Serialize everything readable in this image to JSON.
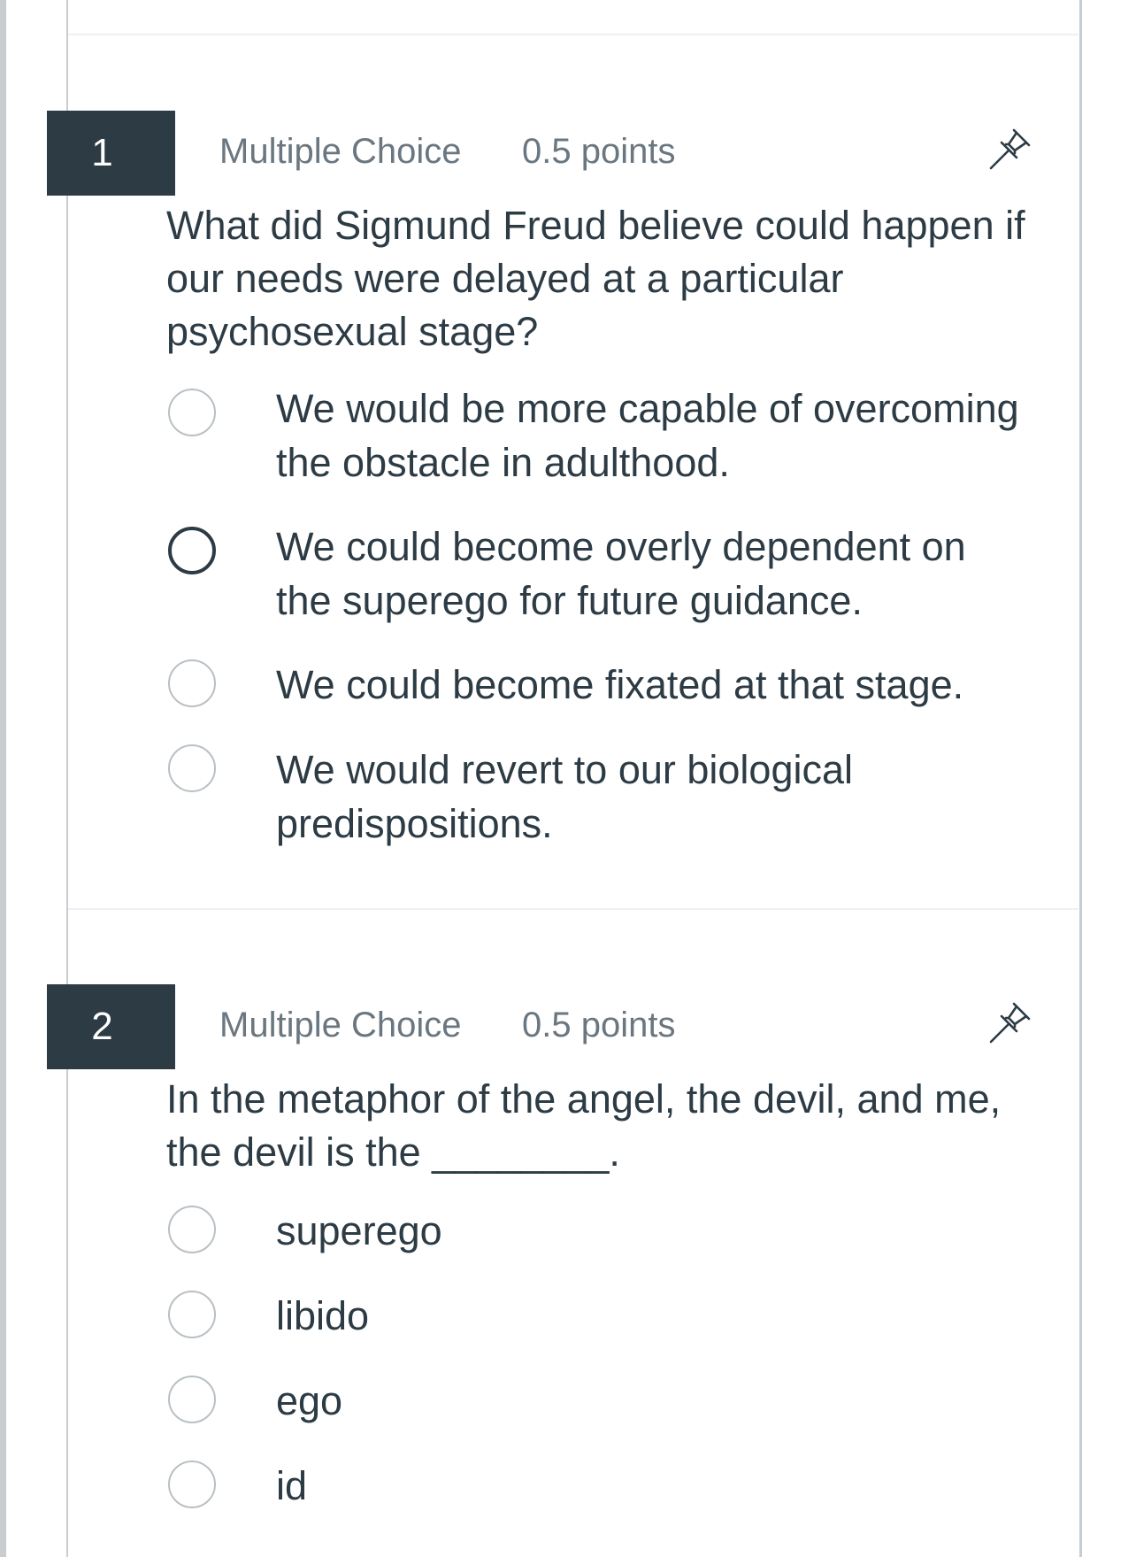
{
  "questions": [
    {
      "number": "1",
      "type": "Multiple Choice",
      "points": "0.5 points",
      "text": "What did Sigmund Freud believe could happen if our needs were delayed at a particular psychosexual stage?",
      "options": [
        "We would be more capable of overcoming the obstacle in adulthood.",
        "We could become overly dependent on the superego for future guidance.",
        "We could become fixated at that stage.",
        "We would revert to our biological predispositions."
      ]
    },
    {
      "number": "2",
      "type": "Multiple Choice",
      "points": "0.5 points",
      "text": "In the metaphor of the angel, the devil, and me, the devil is the ________.",
      "options": [
        "superego",
        "libido",
        "ego",
        "id"
      ]
    }
  ],
  "icons": {
    "pin": "pin-icon"
  },
  "colors": {
    "text": "#2d3b45",
    "muted": "#6b7780",
    "number_badge": "#2d3b45",
    "radio_border": "#b9c0c5"
  }
}
